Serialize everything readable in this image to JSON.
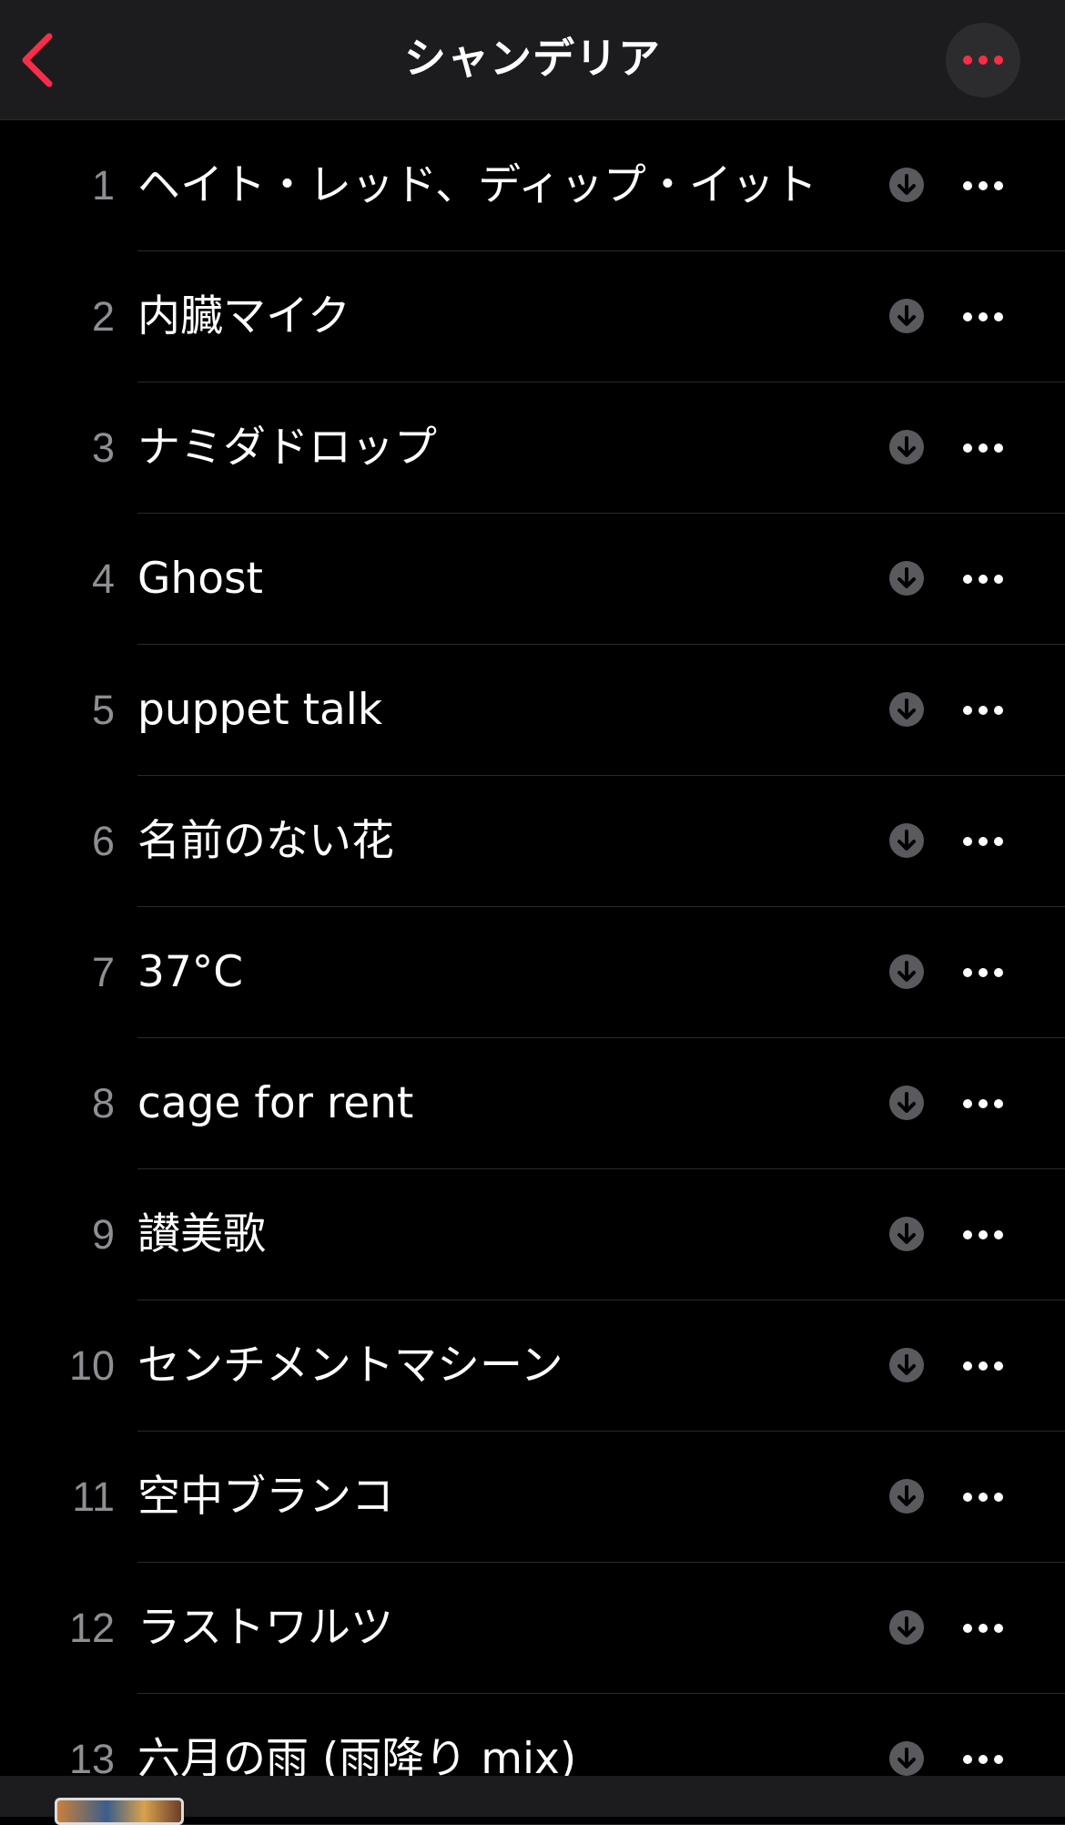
{
  "header": {
    "title": "シャンデリア",
    "accent_color": "#fa2d48"
  },
  "tracks": [
    {
      "number": "1",
      "title": "ヘイト・レッド、ディップ・イット"
    },
    {
      "number": "2",
      "title": "内臓マイク"
    },
    {
      "number": "3",
      "title": "ナミダドロップ"
    },
    {
      "number": "4",
      "title": "Ghost"
    },
    {
      "number": "5",
      "title": "puppet talk"
    },
    {
      "number": "6",
      "title": "名前のない花"
    },
    {
      "number": "7",
      "title": "37°C"
    },
    {
      "number": "8",
      "title": "cage for rent"
    },
    {
      "number": "9",
      "title": "讃美歌"
    },
    {
      "number": "10",
      "title": "センチメントマシーン"
    },
    {
      "number": "11",
      "title": "空中ブランコ"
    },
    {
      "number": "12",
      "title": "ラストワルツ"
    },
    {
      "number": "13",
      "title": "六月の雨 (雨降り mix)"
    }
  ],
  "icons": {
    "back": "chevron-left-icon",
    "more": "ellipsis-icon",
    "download": "download-circle-icon"
  }
}
